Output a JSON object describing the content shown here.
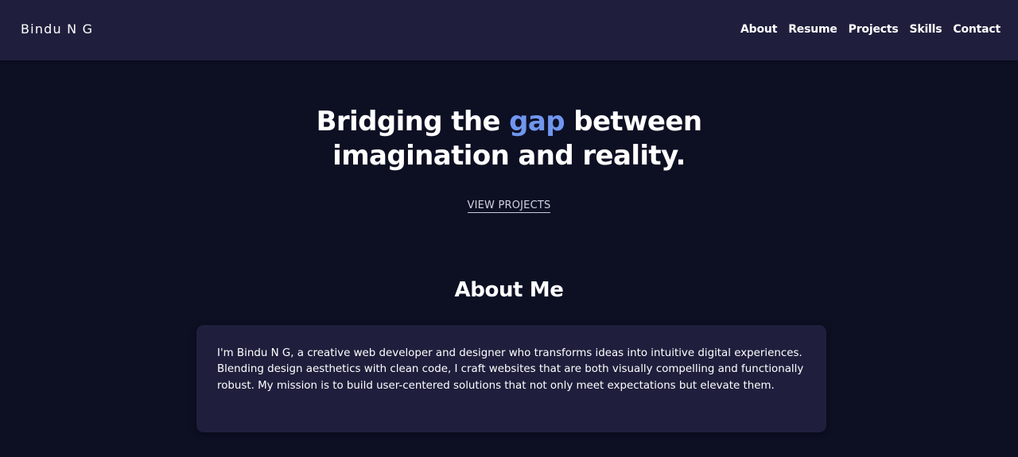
{
  "brand": "Bindu N G",
  "nav": {
    "items": [
      {
        "label": "About"
      },
      {
        "label": "Resume"
      },
      {
        "label": "Projects"
      },
      {
        "label": "Skills"
      },
      {
        "label": "Contact"
      }
    ]
  },
  "hero": {
    "line1_prefix": "Bridging the ",
    "line1_accent": "gap",
    "line1_suffix": " between",
    "line2": "imagination and reality.",
    "cta_label": "VIEW PROJECTS"
  },
  "about": {
    "heading": "About Me",
    "body": "I'm Bindu N G, a creative web developer and designer who transforms ideas into intuitive digital experiences. Blending design aesthetics with clean code, I craft websites that are both visually compelling and functionally robust. My mission is to build user-centered solutions that not only meet expectations but elevate them."
  },
  "colors": {
    "background": "#0d0f23",
    "surface": "#1f1f3d",
    "accent": "#7096ee",
    "text": "#ffffff"
  }
}
